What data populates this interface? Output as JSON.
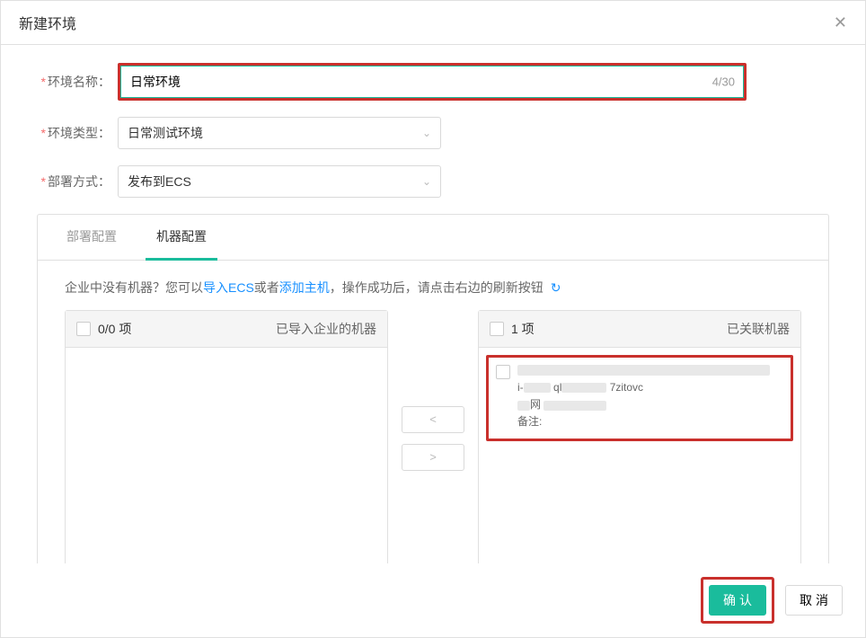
{
  "dialog": {
    "title": "新建环境",
    "close_icon": "✕"
  },
  "form": {
    "name": {
      "label": "环境名称：",
      "value": "日常环境",
      "counter": "4/30"
    },
    "type": {
      "label": "环境类型：",
      "value": "日常测试环境"
    },
    "deploy": {
      "label": "部署方式：",
      "value": "发布到ECS"
    }
  },
  "tabs": {
    "deploy_config": "部署配置",
    "machine_config": "机器配置"
  },
  "hint": {
    "prefix": "企业中没有机器？您可以",
    "import_ecs": "导入ECS",
    "or": "或者",
    "add_host": "添加主机",
    "suffix": "，操作成功后，请点击右边的刷新按钮"
  },
  "transfer": {
    "left": {
      "count": "0/0 项",
      "title": "已导入企业的机器"
    },
    "right": {
      "count": "1 项",
      "title": "已关联机器"
    },
    "item": {
      "id_prefix": "i-",
      "id_mid": "ql",
      "id_suffix": "7zitovc",
      "net": "网",
      "remark": "备注:"
    }
  },
  "footer": {
    "confirm": "确认",
    "cancel": "取消"
  }
}
